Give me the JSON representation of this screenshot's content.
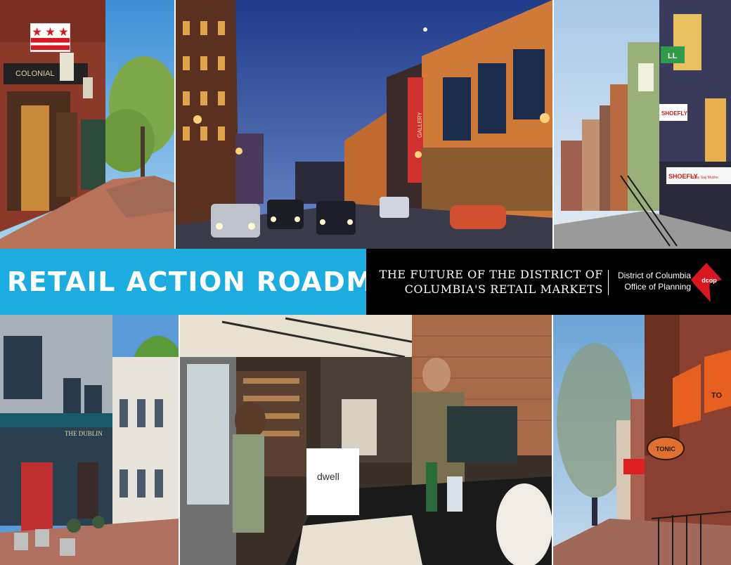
{
  "cover": {
    "title": "RETAIL ACTION ROADMAP",
    "subtitle_lines": [
      "THE FUTURE OF THE DISTRICT OF",
      "COLUMBIA'S RETAIL MARKETS"
    ],
    "agency_lines": [
      "District of Columbia",
      "Office of Planning"
    ],
    "logo_text": "dcop",
    "colors": {
      "band_blue": "#1cace0",
      "band_black": "#000000",
      "logo_red": "#d7191f"
    }
  },
  "photos": {
    "p1": {
      "signs": [
        "COLONIAL"
      ]
    },
    "p2": {
      "signs": [
        "GALLERY"
      ]
    },
    "p3": {
      "signs": [
        "SHOEFLY",
        "SHOEFLY",
        "Baby Say Mucho",
        "LL"
      ]
    },
    "p4": {
      "signs": [
        "THE DUBLIN"
      ]
    },
    "p5": {
      "signs": [
        "dwell"
      ]
    },
    "p6": {
      "signs": [
        "TONIC",
        "TO"
      ]
    }
  }
}
